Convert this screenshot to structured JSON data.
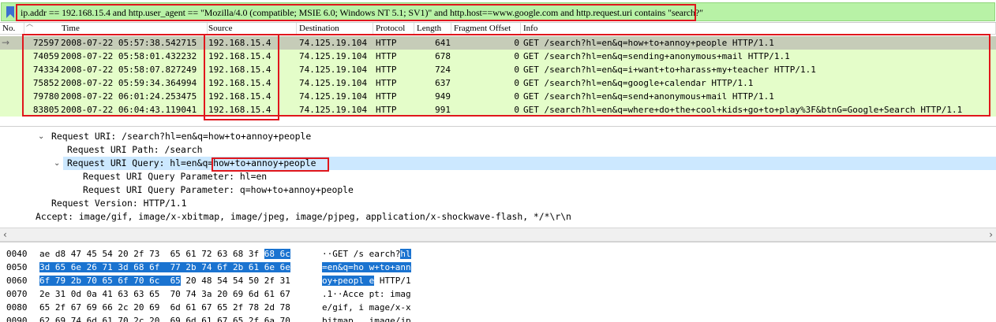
{
  "filter": {
    "text": "ip.addr == 192.168.15.4 and http.user_agent == \"Mozilla/4.0 (compatible; MSIE 6.0; Windows NT 5.1; SV1)\" and http.host==www.google.com and http.request.uri contains \"search?\"",
    "background": "#b8f2a6"
  },
  "columns": [
    "No.",
    "Time",
    "Source",
    "Destination",
    "Protocol",
    "Length",
    "Fragment Offset",
    "Info"
  ],
  "packets": [
    {
      "no": "72597",
      "time": "2008-07-22 05:57:38.542715",
      "src": "192.168.15.4",
      "dst": "74.125.19.104",
      "proto": "HTTP",
      "len": "641",
      "frag": "0",
      "info": "GET /search?hl=en&q=how+to+annoy+people HTTP/1.1",
      "selected": true
    },
    {
      "no": "74059",
      "time": "2008-07-22 05:58:01.432232",
      "src": "192.168.15.4",
      "dst": "74.125.19.104",
      "proto": "HTTP",
      "len": "678",
      "frag": "0",
      "info": "GET /search?hl=en&q=sending+anonymous+mail HTTP/1.1",
      "selected": false
    },
    {
      "no": "74334",
      "time": "2008-07-22 05:58:07.827249",
      "src": "192.168.15.4",
      "dst": "74.125.19.104",
      "proto": "HTTP",
      "len": "724",
      "frag": "0",
      "info": "GET /search?hl=en&q=i+want+to+harass+my+teacher HTTP/1.1",
      "selected": false
    },
    {
      "no": "75852",
      "time": "2008-07-22 05:59:34.364994",
      "src": "192.168.15.4",
      "dst": "74.125.19.104",
      "proto": "HTTP",
      "len": "637",
      "frag": "0",
      "info": "GET /search?hl=en&q=google+calendar HTTP/1.1",
      "selected": false
    },
    {
      "no": "79780",
      "time": "2008-07-22 06:01:24.253475",
      "src": "192.168.15.4",
      "dst": "74.125.19.104",
      "proto": "HTTP",
      "len": "949",
      "frag": "0",
      "info": "GET /search?hl=en&q=send+anonymous+mail HTTP/1.1",
      "selected": false
    },
    {
      "no": "83805",
      "time": "2008-07-22 06:04:43.119041",
      "src": "192.168.15.4",
      "dst": "74.125.19.104",
      "proto": "HTTP",
      "len": "991",
      "frag": "0",
      "info": "GET /search?hl=en&q=where+do+the+cool+kids+go+to+play%3F&btnG=Google+Search HTTP/1.1",
      "selected": false
    }
  ],
  "details": {
    "request_uri": "Request URI: /search?hl=en&q=how+to+annoy+people",
    "uri_path": "Request URI Path: /search",
    "uri_query_prefix": "Request URI Query: hl=en&q=",
    "uri_query_value": "how+to+annoy+people",
    "param1": "Request URI Query Parameter: hl=en",
    "param2": "Request URI Query Parameter: q=how+to+annoy+people",
    "version": "Request Version: HTTP/1.1",
    "accept": "Accept: image/gif, image/x-xbitmap, image/jpeg, image/pjpeg, application/x-shockwave-flash, */*\\r\\n"
  },
  "hex": [
    {
      "offset": "0040",
      "pre": "ae d8 47 45 54 20 2f 73  65 61 72 63 68 3f ",
      "sel": "68 6c",
      "post": "",
      "apre": "··GET /s earch?",
      "asel": "hl",
      "apost": ""
    },
    {
      "offset": "0050",
      "pre": "",
      "sel": "3d 65 6e 26 71 3d 68 6f  77 2b 74 6f 2b 61 6e 6e",
      "post": "",
      "apre": "",
      "asel": "=en&q=ho w+to+ann",
      "apost": ""
    },
    {
      "offset": "0060",
      "pre": "",
      "sel": "6f 79 2b 70 65 6f 70 6c  65",
      "post": " 20 48 54 54 50 2f 31",
      "apre": "",
      "asel": "oy+peopl e",
      "apost": " HTTP/1"
    },
    {
      "offset": "0070",
      "pre": "2e 31 0d 0a 41 63 63 65  70 74 3a 20 69 6d 61 67",
      "sel": "",
      "post": "",
      "apre": ".1··Acce pt: imag",
      "asel": "",
      "apost": ""
    },
    {
      "offset": "0080",
      "pre": "65 2f 67 69 66 2c 20 69  6d 61 67 65 2f 78 2d 78",
      "sel": "",
      "post": "",
      "apre": "e/gif, i mage/x-x",
      "asel": "",
      "apost": ""
    },
    {
      "offset": "0090",
      "pre": "62 69 74 6d 61 70 2c 20  69 6d 61 67 65 2f 6a 70",
      "sel": "",
      "post": "",
      "apre": "bitmap,  image/jp",
      "asel": "",
      "apost": ""
    }
  ],
  "colors": {
    "row_bg": "#e4fdc9",
    "selected_row_bg": "#c6ccb8",
    "annotation_red": "#e0161c",
    "hex_selection": "#1a73d0"
  }
}
